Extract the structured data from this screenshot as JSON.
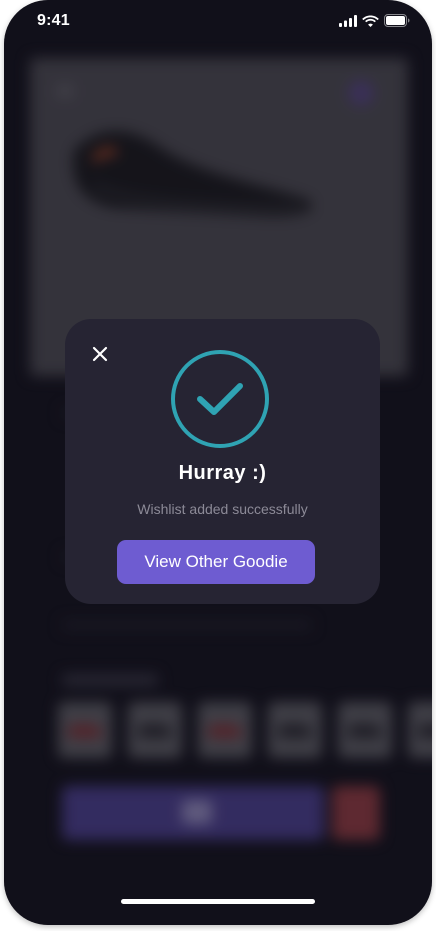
{
  "status_bar": {
    "time": "9:41",
    "icons": [
      "cellular-signal-icon",
      "wifi-icon",
      "battery-icon"
    ]
  },
  "modal": {
    "close_icon": "close-icon",
    "success_icon": "checkmark-circle-icon",
    "title": "Hurray :)",
    "subtitle": "Wishlist added successfully",
    "primary_button_label": "View Other Goodie"
  },
  "colors": {
    "background": "#16141f",
    "modal_background": "#262433",
    "accent": "#6e5cd1",
    "success_ring": "#2fa3b3",
    "subtitle_text": "#8c8a97"
  }
}
